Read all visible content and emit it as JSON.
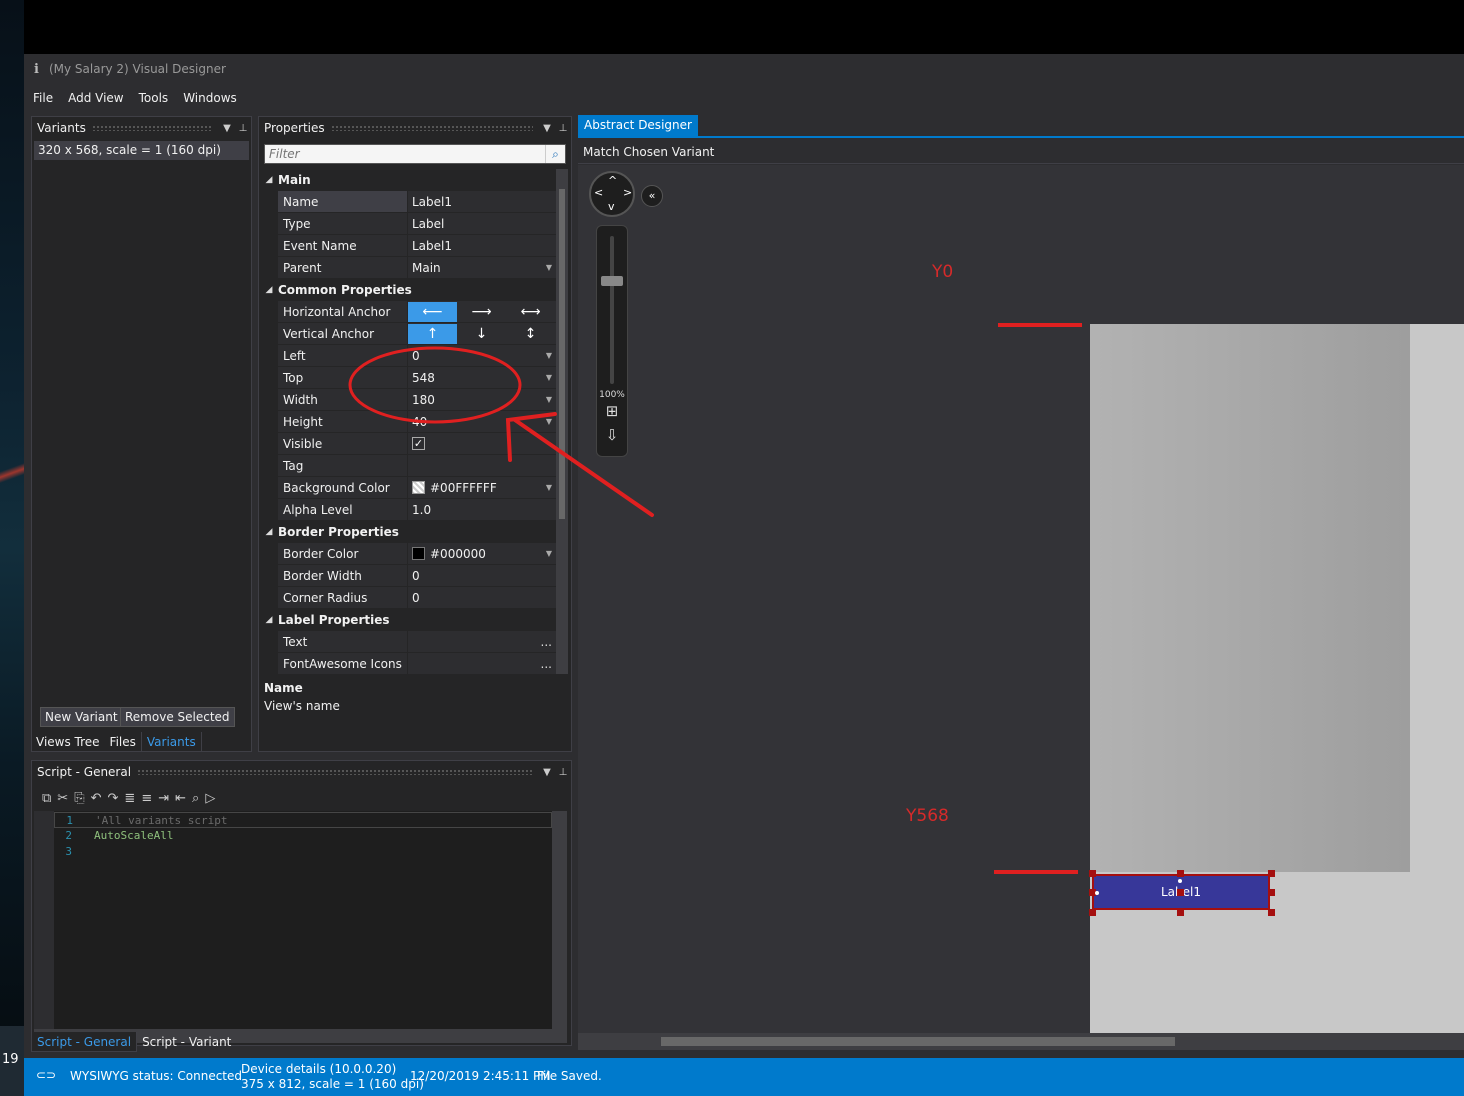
{
  "taskbar": {
    "clock_fragment": "19"
  },
  "window": {
    "title": "(My Salary 2) Visual Designer",
    "app_icon": "i"
  },
  "menu": [
    "File",
    "Add View",
    "Tools",
    "Windows"
  ],
  "variants_panel": {
    "title": "Variants",
    "items": [
      "320 x 568, scale = 1 (160 dpi)"
    ],
    "new_variant_label": "New Variant",
    "remove_selected_label": "Remove Selected",
    "tabs": [
      "Views Tree",
      "Files",
      "Variants"
    ],
    "active_tab": "Variants"
  },
  "properties_panel": {
    "title": "Properties",
    "filter_placeholder": "Filter",
    "categories": {
      "main": "Main",
      "common": "Common Properties",
      "border": "Border Properties",
      "label": "Label Properties"
    },
    "main": [
      {
        "name": "Name",
        "value": "Label1"
      },
      {
        "name": "Type",
        "value": "Label"
      },
      {
        "name": "Event Name",
        "value": "Label1"
      },
      {
        "name": "Parent",
        "value": "Main"
      }
    ],
    "common": {
      "horizontal_anchor": "Horizontal Anchor",
      "vertical_anchor": "Vertical Anchor",
      "rows": [
        {
          "name": "Left",
          "value": "0"
        },
        {
          "name": "Top",
          "value": "548"
        },
        {
          "name": "Width",
          "value": "180"
        },
        {
          "name": "Height",
          "value": "40"
        }
      ],
      "visible": "Visible",
      "tag": "Tag",
      "background_color": {
        "name": "Background Color",
        "value": "#00FFFFFF"
      },
      "alpha_level": {
        "name": "Alpha Level",
        "value": "1.0"
      }
    },
    "border": [
      {
        "name": "Border Color",
        "value": "#000000"
      },
      {
        "name": "Border Width",
        "value": "0"
      },
      {
        "name": "Corner Radius",
        "value": "0"
      }
    ],
    "label": [
      {
        "name": "Text",
        "value": "..."
      },
      {
        "name": "FontAwesome Icons",
        "value": "..."
      }
    ],
    "description": {
      "title": "Name",
      "text": "View's name"
    }
  },
  "designer": {
    "tab": "Abstract Designer",
    "toolbar_label": "Match Chosen Variant",
    "zoom_label": "100%",
    "label_text": "Label1",
    "y0_annotation": "Y0",
    "y568_annotation": "Y568"
  },
  "script_panel": {
    "title": "Script - General",
    "lines": [
      {
        "num": "1",
        "text": "'All variants script"
      },
      {
        "num": "2",
        "text": "AutoScaleAll"
      },
      {
        "num": "3",
        "text": ""
      }
    ],
    "tabs": [
      "Script - General",
      "Script - Variant"
    ],
    "active_tab": "Script - General"
  },
  "status_bar": {
    "wysiwyg": "WYSIWYG status: Connected",
    "device_line1": "Device details (10.0.0.20)",
    "device_line2": "375 x 812, scale = 1 (160 dpi)",
    "timestamp": "12/20/2019 2:45:11 PM",
    "file_status": "File Saved."
  },
  "colors": {
    "accent": "#007acc",
    "selection_blue": "#3b9ae8",
    "annotation_red": "#d62a2a",
    "label_fill": "#373799"
  },
  "icons": [
    "search-icon",
    "pin-icon",
    "dropdown-arrow-icon",
    "arrow-left-icon",
    "arrow-right-icon",
    "arrow-both-horizontal-icon",
    "arrow-up-icon",
    "arrow-down-icon",
    "arrow-both-vertical-icon",
    "checkbox-icon",
    "nav-pad-icon",
    "collapse-icon",
    "fit-screen-icon",
    "export-icon",
    "link-icon"
  ]
}
